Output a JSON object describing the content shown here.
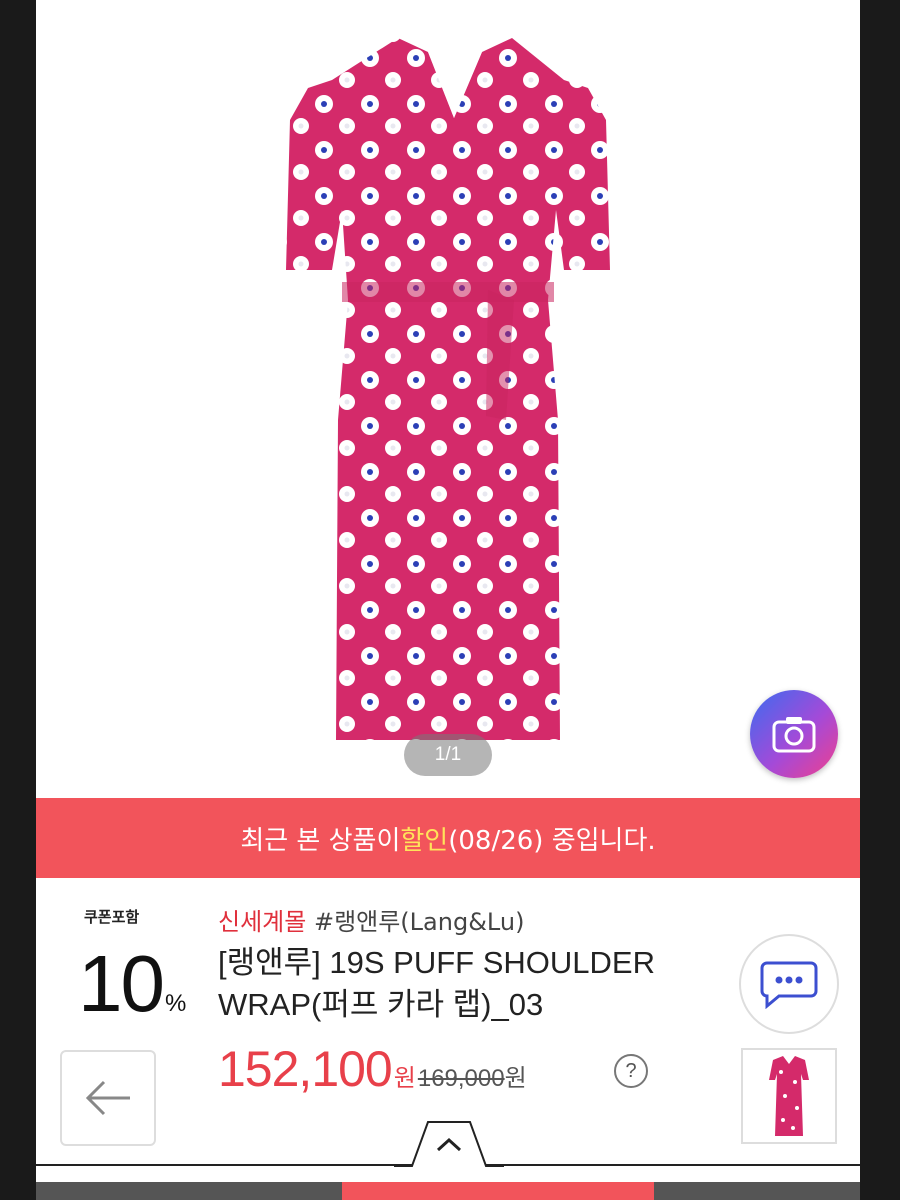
{
  "image": {
    "pager": "1/1"
  },
  "banner": {
    "prefix": "최근 본 상품이 ",
    "highlight": "할인",
    "suffix": "(08/26) 중입니다."
  },
  "product": {
    "coupon_label": "쿠폰포함",
    "discount_number": "10",
    "discount_unit": "%",
    "store": "신세계몰",
    "brand_tag": " #랭앤루(Lang&Lu)",
    "title": "[랭앤루] 19S PUFF SHOULDER WRAP(퍼프 카라 랩)_03",
    "price": "152,100",
    "price_unit": "원",
    "original_price": "169,000",
    "original_unit": "원",
    "help_label": "?"
  },
  "colors": {
    "accent": "#f2545b",
    "price": "#e8404a",
    "store": "#e0303c",
    "highlight": "#ffe35a"
  },
  "icons": {
    "camera": "camera-icon",
    "chat": "chat-bubble-icon",
    "back": "arrow-left-icon",
    "collapse": "chevron-up-icon",
    "help": "question-icon"
  }
}
